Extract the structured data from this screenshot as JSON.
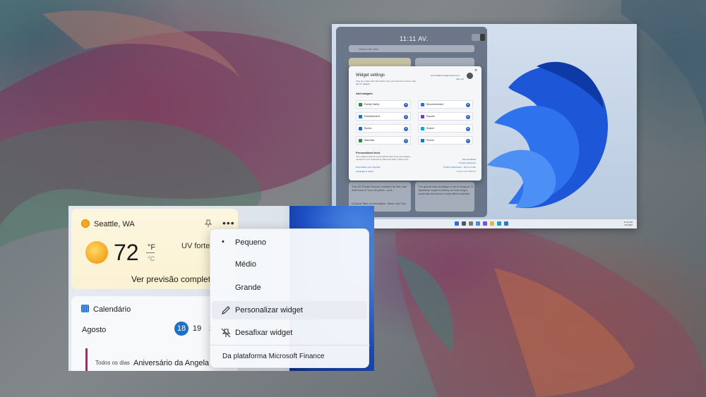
{
  "desktop": {
    "panel_time": "11:11 AV.",
    "search_placeholder": "Search the web",
    "tray_time": "11:11 AM",
    "tray_date": "4/1/2022"
  },
  "widget_settings": {
    "title": "Widget settings",
    "subtitle": "Stay up to date with information from your favorite services.",
    "subtitle_link": "See tips for widgets",
    "email": "personalaccount@outlook.com",
    "sign_out": "Sign out",
    "add_widgets_heading": "Add widgets",
    "widgets": [
      {
        "label": "Family Safety",
        "color": "#2d8a3e"
      },
      {
        "label": "Recommended",
        "color": "#3a6fd0"
      },
      {
        "label": "Entertainment",
        "color": "#1b6fd0"
      },
      {
        "label": "Esports",
        "color": "#6b3cc9"
      },
      {
        "label": "Sports",
        "color": "#2b62b9"
      },
      {
        "label": "Search",
        "color": "#14a0d0"
      },
      {
        "label": "Watchlist",
        "color": "#2d8a3e"
      },
      {
        "label": "Photos",
        "color": "#1b6fd0"
      }
    ],
    "feed_heading": "Personalized feed",
    "feed_text": "Your widgets board is personalized with news and widgets relevant to you. Powered by Microsoft Start.",
    "feed_learn_more": "Learn more",
    "links_left": [
      "Personalize your interests",
      "Language & region"
    ],
    "links_right": [
      "Give feedback",
      "Privacy statement",
      "Privacy Dashboard · Terms of Use",
      "Version 421.20070.0"
    ],
    "news": [
      "The US Postal Service revealed its first new mail truck in over 30 years - and...",
      "The global chip shortage is set to drag on. A Japanese expert's theory on how long it could last and how it could affect markets",
      "A Quick Take on Innovation: Stars Can Tour"
    ]
  },
  "weather": {
    "location": "Seattle, WA",
    "temperature": "72",
    "unit_f": "°F",
    "unit_c": "°C",
    "uv": "UV forte",
    "forecast_link": "Ver previsão completa",
    "pin_icon": "pin-icon",
    "more_icon": "more-options-icon"
  },
  "calendar": {
    "title": "Calendário",
    "month": "Agosto",
    "days": [
      "18",
      "19",
      "2"
    ],
    "selected_day": "18",
    "event_all_day": "Todos os dias",
    "event_title": "Aniversário da Angela"
  },
  "context_menu": {
    "items": [
      {
        "label": "Pequeno",
        "selected": true
      },
      {
        "label": "Médio"
      },
      {
        "label": "Grande"
      },
      {
        "label": "Personalizar widget",
        "icon": "pencil-icon"
      },
      {
        "label": "Desafixar widget",
        "icon": "unpin-icon"
      }
    ],
    "footer": "Da plataforma Microsoft Finance"
  },
  "colors": {
    "accent": "#1f6fc6",
    "calendar_event": "#b1207e",
    "weather_card": "#fbf2d3"
  }
}
